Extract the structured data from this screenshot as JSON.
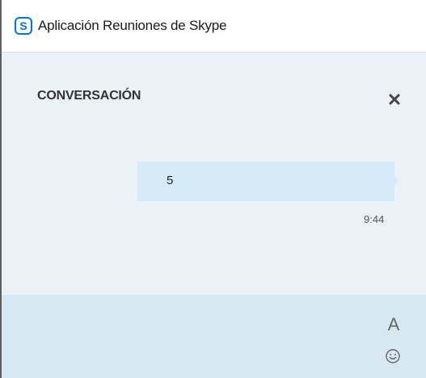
{
  "window": {
    "title": "Aplicación Reuniones de Skype",
    "logo_icon": "skype-logo-icon",
    "brand_color": "#0078d7"
  },
  "conversation": {
    "header_title": "CONVERSACIÓN",
    "close_icon": "close-icon",
    "messages": [
      {
        "text": "5",
        "time": "9:44"
      }
    ]
  },
  "input": {
    "font_icon": "A",
    "emoji_icon": "emoji-icon"
  }
}
